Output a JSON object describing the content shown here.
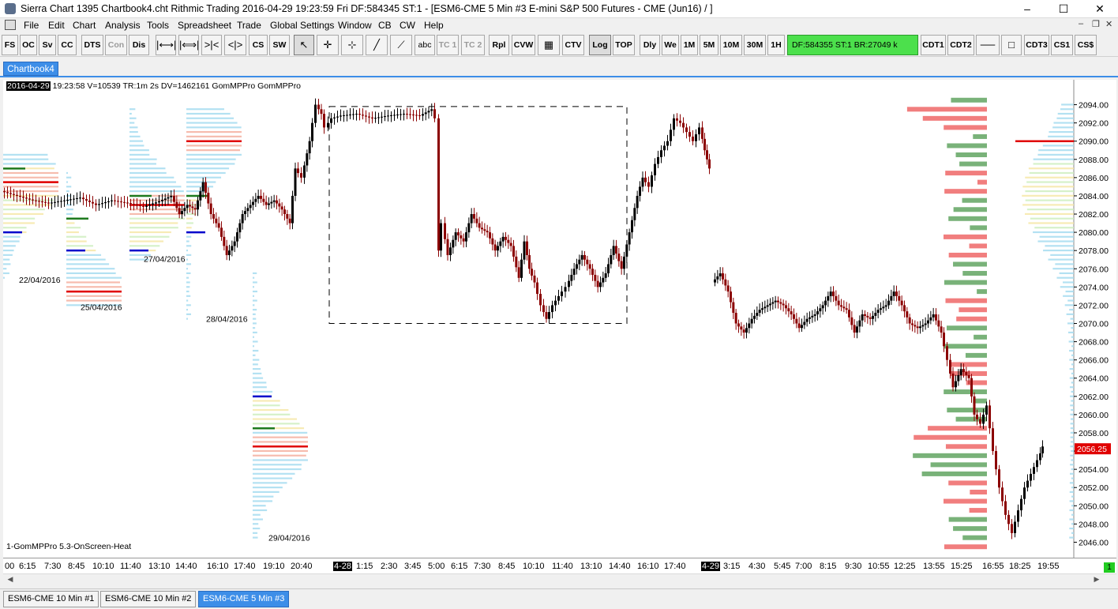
{
  "window": {
    "title": "Sierra Chart 1395 Chartbook4.cht  Rithmic Trading 2016-04-29  19:23:59 Fri  DF:584345  ST:1 - [ESM6-CME  5 Min  #3  E-mini S&P 500 Futures - CME (Jun16)  /  ]",
    "minimize": "–",
    "maximize": "☐",
    "close": "✕"
  },
  "menu": {
    "items": [
      "File",
      "Edit",
      "Chart",
      "Analysis",
      "Tools",
      "Spreadsheet",
      "Trade",
      "Global Settings",
      "Window",
      "CB",
      "CW",
      "Help"
    ],
    "mdi_minimize": "–",
    "mdi_restore": "❐",
    "mdi_close": "✕"
  },
  "toolbar": {
    "buttons": [
      "FS",
      "OC",
      "Sv",
      "CC",
      "DTS",
      "Con",
      "Dis",
      "",
      "",
      "",
      "",
      "CS",
      "SW",
      "",
      "",
      "",
      "",
      "",
      "abc",
      "TC 1",
      "TC 2",
      "Rpl",
      "CVW",
      "",
      "CTV",
      "Log",
      "TOP",
      "Dly",
      "We",
      "1M",
      "5M",
      "10M",
      "30M",
      "1H",
      "CDT1",
      "CDT2",
      "",
      "",
      "CDT3",
      "CS1",
      "CS$"
    ],
    "icons": {
      "fit_width": "|⟷|",
      "fit_width_2": "|⟺|",
      "zoom_in": ">|<",
      "zoom_out": "<|>",
      "pointer": "↖",
      "crosshair": "✛",
      "cursor_line": "⊹",
      "line_tool": "╱",
      "ray_tool": "⟋",
      "grid_tool": "▦",
      "hline": "──",
      "rect": "□"
    },
    "status_text": "DF:584355  ST:1  BR:27049 k"
  },
  "chartbook_tab": "Chartbook4",
  "chart": {
    "header_date": "2016-04-29",
    "header_info": " 19:23:58 V=10539 TR:1m 2s DV=1462161  GomMPPro  GomMPPro",
    "study_label": "1-GomMPPro 5.3-OnScreen-Heat",
    "current_price": "2056.25",
    "profile_dates": [
      "22/04/2016",
      "25/04/2016",
      "27/04/2016",
      "28/04/2016",
      "29/04/2016"
    ],
    "colors": {
      "candle_up": "#000000",
      "candle_down": "#8b0000",
      "poc": "#e00000",
      "va_high": "#1e7a1e",
      "va_low": "#0000cc",
      "profile_green": "#6aaa6a",
      "profile_red": "#f07070",
      "price_marker": "#e00000"
    }
  },
  "chart_data": {
    "type": "candlestick",
    "symbol": "ESM6-CME 5 Min",
    "ylim": [
      2045,
      2095
    ],
    "y_ticks": [
      "2094.00",
      "2092.00",
      "2090.00",
      "2088.00",
      "2086.00",
      "2084.00",
      "2082.00",
      "2080.00",
      "2078.00",
      "2076.00",
      "2074.00",
      "2072.00",
      "2070.00",
      "2068.00",
      "2066.00",
      "2064.00",
      "2062.00",
      "2060.00",
      "2058.00",
      "2056.00",
      "2054.00",
      "2052.00",
      "2050.00",
      "2048.00",
      "2046.00"
    ],
    "x_tick_labels": [
      "00",
      "6:15",
      "7:30",
      "8:45",
      "10:10",
      "11:40",
      "13:10",
      "14:40",
      "16:10",
      "17:40",
      "19:10",
      "20:40",
      "4-28",
      "1:15",
      "2:30",
      "3:45",
      "5:00",
      "6:15",
      "7:30",
      "8:45",
      "10:10",
      "11:40",
      "13:10",
      "14:40",
      "16:10",
      "17:40",
      "4-29",
      "3:15",
      "4:30",
      "5:45",
      "7:00",
      "8:15",
      "9:30",
      "10:55",
      "12:25",
      "13:55",
      "15:25",
      "16:55",
      "18:25",
      "19:55"
    ],
    "x_tick_highlight": [
      "4-28",
      "4-29"
    ],
    "price_path": [
      [
        0,
        2084.5
      ],
      [
        20,
        2084.0
      ],
      [
        40,
        2083.5
      ],
      [
        60,
        2083.2
      ],
      [
        80,
        2083.5
      ],
      [
        100,
        2083.8
      ],
      [
        120,
        2083.0
      ],
      [
        140,
        2083.5
      ],
      [
        160,
        2083.2
      ],
      [
        180,
        2082.8
      ],
      [
        200,
        2083.4
      ],
      [
        215,
        2084.0
      ],
      [
        225,
        2082.0
      ],
      [
        235,
        2083.0
      ],
      [
        245,
        2082.5
      ],
      [
        255,
        2085.5
      ],
      [
        265,
        2082.0
      ],
      [
        275,
        2080.5
      ],
      [
        285,
        2077.5
      ],
      [
        295,
        2079.0
      ],
      [
        305,
        2082.0
      ],
      [
        315,
        2083.0
      ],
      [
        325,
        2084.0
      ],
      [
        335,
        2083.0
      ],
      [
        345,
        2083.5
      ],
      [
        355,
        2082.5
      ],
      [
        365,
        2081.0
      ],
      [
        372,
        2087.0
      ],
      [
        380,
        2086.0
      ],
      [
        390,
        2090.0
      ],
      [
        398,
        2094.0
      ],
      [
        405,
        2093.0
      ],
      [
        410,
        2091.5
      ],
      [
        418,
        2092.5
      ],
      [
        430,
        2092.8
      ],
      [
        450,
        2093.0
      ],
      [
        470,
        2092.5
      ],
      [
        490,
        2092.8
      ],
      [
        510,
        2093.0
      ],
      [
        530,
        2092.8
      ],
      [
        545,
        2093.5
      ],
      [
        550,
        2092.5
      ],
      [
        553,
        2078.0
      ],
      [
        558,
        2081.0
      ],
      [
        565,
        2077.5
      ],
      [
        575,
        2080.0
      ],
      [
        585,
        2079.0
      ],
      [
        595,
        2082.0
      ],
      [
        605,
        2080.5
      ],
      [
        615,
        2080.0
      ],
      [
        625,
        2078.0
      ],
      [
        635,
        2079.5
      ],
      [
        645,
        2078.5
      ],
      [
        655,
        2075.0
      ],
      [
        662,
        2079.0
      ],
      [
        668,
        2076.0
      ],
      [
        675,
        2074.5
      ],
      [
        683,
        2072.0
      ],
      [
        690,
        2070.5
      ],
      [
        698,
        2072.0
      ],
      [
        706,
        2073.0
      ],
      [
        715,
        2074.0
      ],
      [
        725,
        2076.0
      ],
      [
        735,
        2077.5
      ],
      [
        745,
        2076.0
      ],
      [
        755,
        2074.0
      ],
      [
        765,
        2075.5
      ],
      [
        775,
        2078.5
      ],
      [
        785,
        2076.0
      ],
      [
        795,
        2080.0
      ],
      [
        805,
        2084.0
      ],
      [
        812,
        2086.0
      ],
      [
        820,
        2085.0
      ],
      [
        828,
        2087.5
      ],
      [
        836,
        2089.0
      ],
      [
        844,
        2090.0
      ],
      [
        852,
        2092.5
      ],
      [
        860,
        2092.0
      ],
      [
        868,
        2091.0
      ],
      [
        876,
        2090.0
      ],
      [
        884,
        2091.5
      ],
      [
        890,
        2089.0
      ],
      [
        896,
        2087.0
      ]
    ],
    "price_path_day2": [
      [
        900,
        2074.5
      ],
      [
        910,
        2075.5
      ],
      [
        920,
        2073.5
      ],
      [
        930,
        2070.0
      ],
      [
        940,
        2069.0
      ],
      [
        950,
        2070.5
      ],
      [
        960,
        2071.5
      ],
      [
        970,
        2072.0
      ],
      [
        980,
        2072.5
      ],
      [
        990,
        2072.0
      ],
      [
        1000,
        2071.0
      ],
      [
        1010,
        2069.5
      ],
      [
        1020,
        2070.5
      ],
      [
        1030,
        2071.0
      ],
      [
        1040,
        2072.0
      ],
      [
        1050,
        2073.5
      ],
      [
        1060,
        2072.0
      ],
      [
        1070,
        2071.5
      ],
      [
        1080,
        2069.0
      ],
      [
        1090,
        2071.0
      ],
      [
        1100,
        2070.5
      ],
      [
        1110,
        2071.5
      ],
      [
        1120,
        2072.0
      ],
      [
        1130,
        2073.5
      ],
      [
        1140,
        2072.0
      ],
      [
        1150,
        2070.0
      ],
      [
        1160,
        2069.5
      ],
      [
        1170,
        2070.0
      ],
      [
        1180,
        2071.0
      ],
      [
        1190,
        2069.0
      ],
      [
        1198,
        2066.0
      ],
      [
        1205,
        2063.0
      ],
      [
        1215,
        2065.0
      ],
      [
        1225,
        2064.0
      ],
      [
        1232,
        2060.0
      ],
      [
        1240,
        2059.0
      ],
      [
        1248,
        2061.0
      ],
      [
        1256,
        2056.0
      ],
      [
        1264,
        2052.0
      ],
      [
        1272,
        2049.0
      ],
      [
        1280,
        2047.0
      ],
      [
        1288,
        2049.5
      ],
      [
        1296,
        2052.0
      ],
      [
        1304,
        2053.5
      ],
      [
        1312,
        2055.0
      ],
      [
        1318,
        2056.5
      ]
    ],
    "profiles": [
      {
        "date": "22/04/2016",
        "x_start": 0,
        "high": 2088.5,
        "low": 2075.0,
        "poc": 2085.5,
        "vah": 2087.0,
        "val": 2080.0
      },
      {
        "date": "25/04/2016",
        "x_start": 80,
        "high": 2086.5,
        "low": 2072.0,
        "poc": 2073.5,
        "vah": 2081.5,
        "val": 2078.0
      },
      {
        "date": "27/04/2016",
        "x_start": 160,
        "high": 2093.5,
        "low": 2077.0,
        "poc": 2083.0,
        "vah": 2084.0,
        "val": 2078.0
      },
      {
        "date": "28/04/2016",
        "x_start": 232,
        "high": 2093.5,
        "low": 2070.5,
        "poc": 2090.0,
        "vah": 2084.0,
        "val": 2080.0
      },
      {
        "date": "29/04/2016",
        "x_start": 316,
        "high": 2075.5,
        "low": 2046.5,
        "poc": 2056.5,
        "vah": 2058.5,
        "val": 2062.0
      }
    ]
  },
  "timeaxis": {
    "green_box": "1"
  },
  "bottom_tabs": [
    "ESM6-CME  10 Min  #1",
    "ESM6-CME  10 Min  #2",
    "ESM6-CME  5 Min  #3"
  ]
}
